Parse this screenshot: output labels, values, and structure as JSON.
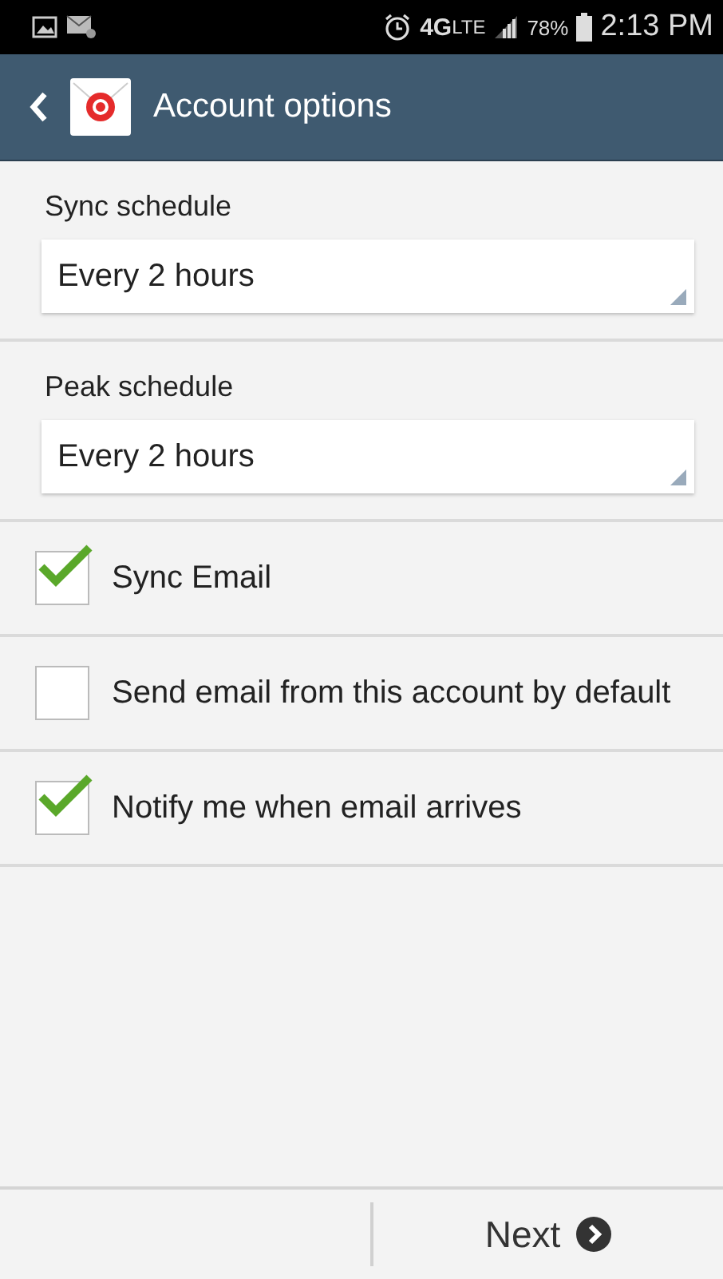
{
  "status_bar": {
    "network": "4G",
    "network_sub": "LTE",
    "battery": "78%",
    "time": "2:13 PM"
  },
  "action_bar": {
    "title": "Account options"
  },
  "schedules": [
    {
      "label": "Sync schedule",
      "value": "Every 2 hours"
    },
    {
      "label": "Peak schedule",
      "value": "Every 2 hours"
    }
  ],
  "options": [
    {
      "label": "Sync Email",
      "checked": true
    },
    {
      "label": "Send email from this account by default",
      "checked": false
    },
    {
      "label": "Notify me when email arrives",
      "checked": true
    }
  ],
  "footer": {
    "next": "Next"
  }
}
